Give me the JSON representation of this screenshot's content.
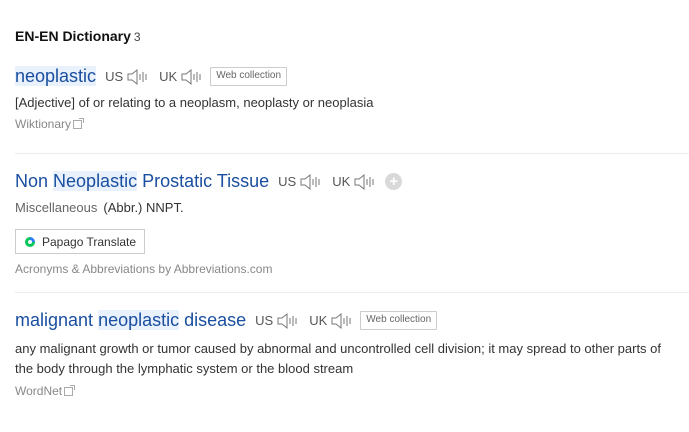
{
  "section": {
    "title": "EN-EN Dictionary",
    "count": "3"
  },
  "entries": [
    {
      "word_hl": "neoplastic",
      "us": "US",
      "uk": "UK",
      "badge": "Web collection",
      "definition": "[Adjective] of or relating to a neoplasm, neoplasty or neoplasia",
      "source": "Wiktionary"
    },
    {
      "word_pre": "Non ",
      "word_hl": "Neoplastic",
      "word_post": " Prostatic Tissue",
      "us": "US",
      "uk": "UK",
      "plus": "+",
      "category": "Miscellaneous",
      "abbr": "(Abbr.) NNPT.",
      "translate_label": "Papago Translate",
      "source": "Acronyms & Abbreviations by Abbreviations.com"
    },
    {
      "word_pre": "malignant ",
      "word_hl": "neoplastic",
      "word_post": " disease",
      "us": "US",
      "uk": "UK",
      "badge": "Web collection",
      "definition": "any malignant growth or tumor caused by abnormal and uncontrolled cell division; it may spread to other parts of the body through the lymphatic system or the blood stream",
      "source": "WordNet"
    }
  ],
  "colors": {
    "link": "#1a4fa0",
    "highlight": "#e8f1fc",
    "papago_green": "#03c75a",
    "papago_blue": "#2c7ff6"
  },
  "icons": {
    "speaker": "speaker-icon",
    "external": "external-link-icon",
    "papago": "papago-icon",
    "plus": "plus-icon"
  }
}
